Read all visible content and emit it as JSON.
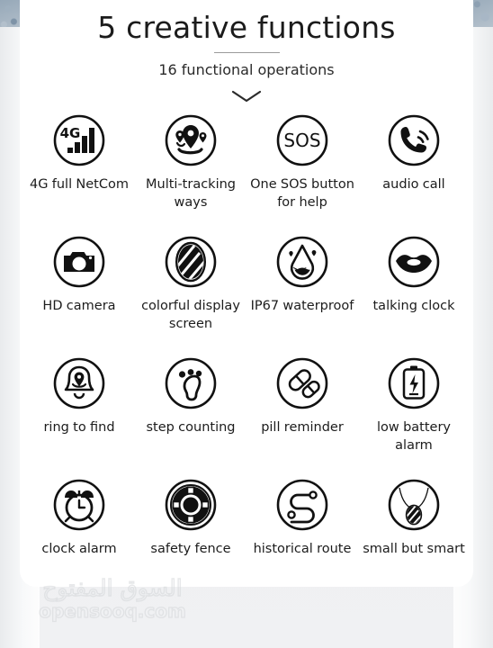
{
  "header": {
    "title": "5 creative functions",
    "subtitle": "16 functional operations",
    "chevron_icon": "chevron-down-icon"
  },
  "features": [
    {
      "icon": "signal-4g-icon",
      "label": "4G full NetCom"
    },
    {
      "icon": "map-pins-icon",
      "label": "Multi-tracking ways"
    },
    {
      "icon": "sos-icon",
      "label": "One SOS button for help"
    },
    {
      "icon": "phone-call-icon",
      "label": "audio call"
    },
    {
      "icon": "camera-icon",
      "label": "HD camera"
    },
    {
      "icon": "display-screen-icon",
      "label": "colorful display screen"
    },
    {
      "icon": "water-drop-icon",
      "label": "IP67 waterproof"
    },
    {
      "icon": "lips-icon",
      "label": "talking clock"
    },
    {
      "icon": "bell-locate-icon",
      "label": "ring to find"
    },
    {
      "icon": "footprint-icon",
      "label": "step counting"
    },
    {
      "icon": "pills-icon",
      "label": "pill reminder"
    },
    {
      "icon": "battery-low-icon",
      "label": "low battery alarm"
    },
    {
      "icon": "alarm-clock-icon",
      "label": "clock alarm"
    },
    {
      "icon": "geofence-icon",
      "label": "safety fence"
    },
    {
      "icon": "route-path-icon",
      "label": "historical route"
    },
    {
      "icon": "necklace-pendant-icon",
      "label": "small but smart"
    }
  ],
  "watermark": {
    "arabic": "السوق المفتوح",
    "latin": "opensooq",
    "suffix": ".com"
  },
  "colors": {
    "ink": "#1b1b1b",
    "divider": "#9a9a9a",
    "card": "#ffffff",
    "page_background": "#e9eaec"
  }
}
